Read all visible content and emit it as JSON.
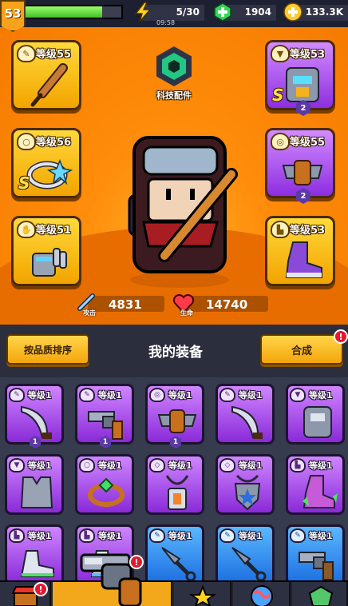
{
  "player": {
    "level": "53",
    "xp_fraction": 0.8
  },
  "resources": {
    "energy": {
      "value": "5/30",
      "timer": "09:58",
      "icon": "lightning-icon"
    },
    "gems": {
      "value": "1904",
      "icon": "green-gem-plus-icon"
    },
    "coins": {
      "value": "133.3K",
      "icon": "coin-plus-icon"
    }
  },
  "tech": {
    "label": "科技配件"
  },
  "slots": [
    {
      "id": "weapon",
      "level": "等级55",
      "rarity": "gold",
      "icon": "baseball-bat-icon"
    },
    {
      "id": "armor",
      "level": "等级53",
      "rarity": "purple",
      "icon": "armor-icon",
      "s": true,
      "badge": "2"
    },
    {
      "id": "ring",
      "level": "等级56",
      "rarity": "gold",
      "icon": "ring-icon",
      "s": true
    },
    {
      "id": "belt",
      "level": "等级55",
      "rarity": "purple",
      "icon": "belt-icon",
      "badge": "2"
    },
    {
      "id": "gloves",
      "level": "等级51",
      "rarity": "gold",
      "icon": "gauntlet-icon"
    },
    {
      "id": "boots",
      "level": "等级53",
      "rarity": "gold",
      "icon": "boots-icon"
    }
  ],
  "s_label": "S",
  "stats": {
    "attack": {
      "value": "4831",
      "label": "攻击"
    },
    "health": {
      "value": "14740",
      "label": "生命"
    }
  },
  "panel": {
    "sort_label": "按品质排序",
    "title": "我的装备",
    "merge_label": "合成",
    "alert": "!"
  },
  "items": [
    {
      "level": "等级1",
      "rarity": "purple",
      "icon": "machete-icon",
      "badge": "1"
    },
    {
      "level": "等级1",
      "rarity": "purple",
      "icon": "revolver-icon",
      "badge": "1"
    },
    {
      "level": "等级1",
      "rarity": "purple",
      "icon": "belt-icon",
      "badge": "1"
    },
    {
      "level": "等级1",
      "rarity": "purple",
      "icon": "machete-icon"
    },
    {
      "level": "等级1",
      "rarity": "purple",
      "icon": "armor-icon"
    },
    {
      "level": "等级1",
      "rarity": "purple",
      "icon": "vest-icon"
    },
    {
      "level": "等级1",
      "rarity": "purple",
      "icon": "ring-icon"
    },
    {
      "level": "等级1",
      "rarity": "purple",
      "icon": "amulet-icon"
    },
    {
      "level": "等级1",
      "rarity": "purple",
      "icon": "shield-pendant-icon"
    },
    {
      "level": "等级1",
      "rarity": "purple",
      "icon": "spiked-boots-icon"
    },
    {
      "level": "等级1",
      "rarity": "purple",
      "icon": "sneakers-icon"
    },
    {
      "level": "等级1",
      "rarity": "purple",
      "icon": "sneakers-icon"
    },
    {
      "level": "等级1",
      "rarity": "blue",
      "icon": "kunai-icon"
    },
    {
      "level": "等级1",
      "rarity": "blue",
      "icon": "kunai-icon"
    },
    {
      "level": "等级1",
      "rarity": "blue",
      "icon": "revolver-icon"
    }
  ],
  "nav": {
    "tabs": [
      "shop-icon",
      "equipment-icon",
      "stars-icon",
      "globe-icon",
      "locked-icon"
    ],
    "alert": "!"
  },
  "colors": {
    "gold": "#f4a50c",
    "purple": "#8a2ad8",
    "blue": "#1c6fe0",
    "hero_bg": "#ff8c0a"
  }
}
